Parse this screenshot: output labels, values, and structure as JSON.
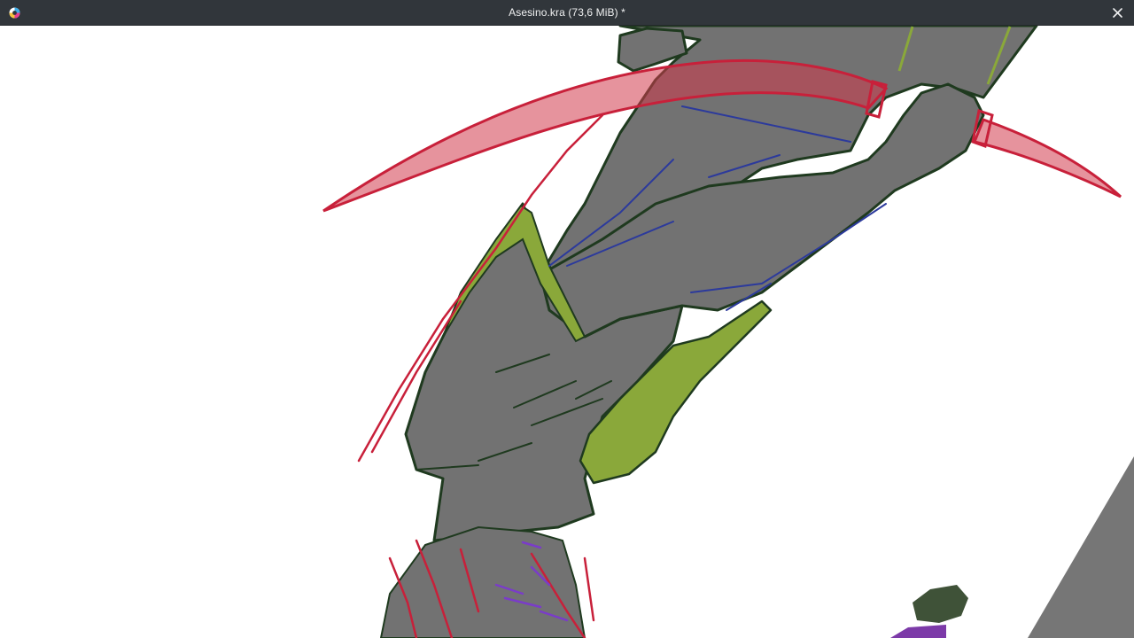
{
  "window": {
    "title": "Asesino.kra (73,6 MiB) *",
    "app_icon": "krita-icon",
    "close_icon": "close-icon"
  },
  "canvas": {
    "content": "illustration-artwork",
    "colors": {
      "background": "#ffffff",
      "body_fill": "#727272",
      "outline": "#1f3a1f",
      "blade": "#c8203a",
      "shirt": "#8aa83a",
      "shading_blue": "#2c3a9c",
      "shading_purple": "#7a3cc8",
      "hair_dark": "#3f5238",
      "purple_fabric": "#7c3aa8"
    }
  },
  "theme": {
    "titlebar_bg": "#31363b",
    "titlebar_text": "#eff0f1"
  }
}
